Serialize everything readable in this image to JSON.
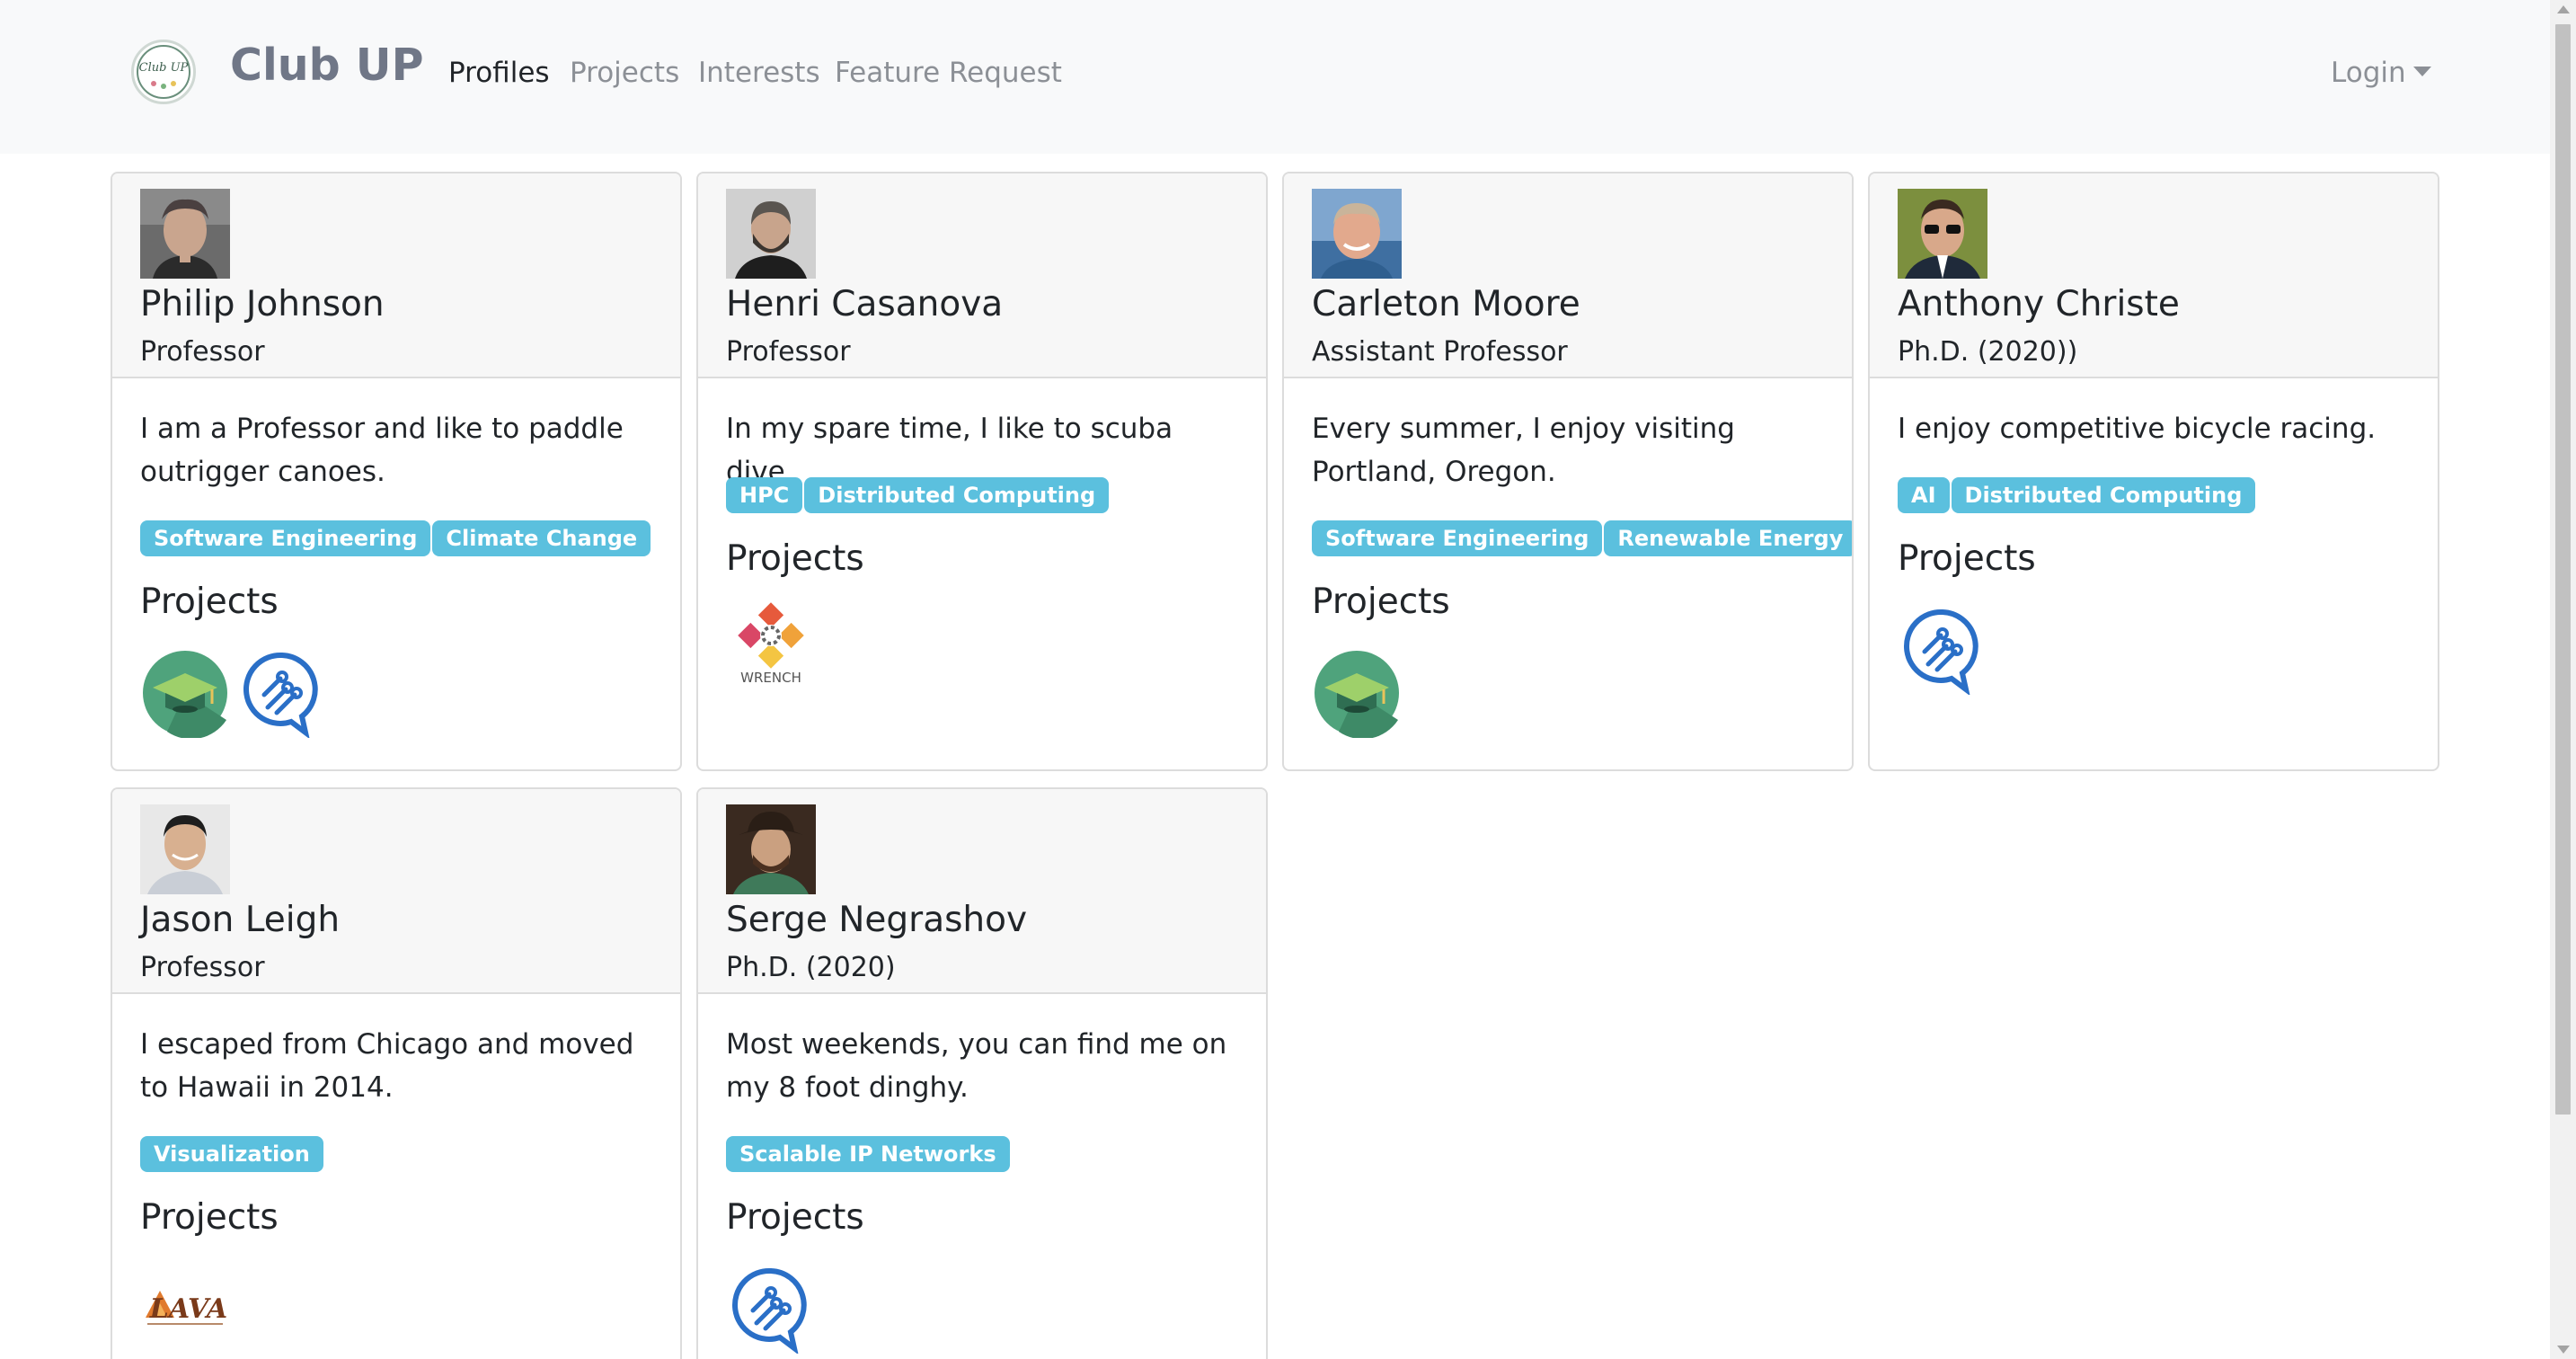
{
  "navbar": {
    "brand": "Club UP",
    "logo_text": "Club UP",
    "links": [
      {
        "label": "Profiles",
        "active": true
      },
      {
        "label": "Projects",
        "active": false
      },
      {
        "label": "Interests",
        "active": false
      },
      {
        "label": "Feature Request",
        "active": false
      }
    ],
    "login_label": "Login"
  },
  "colors": {
    "navbar_bg": "#f8f9fa",
    "badge_bg": "#5bc0de",
    "card_header_bg": "#f7f7f7"
  },
  "profiles": [
    {
      "name": "Philip Johnson",
      "title": "Professor",
      "bio": "I am a Professor and like to paddle outrigger canoes.",
      "interests": [
        "Software Engineering",
        "Climate Change"
      ],
      "projects_heading": "Projects",
      "projects": [
        "graduation-cap-icon",
        "chat-circuit-icon"
      ]
    },
    {
      "name": "Henri Casanova",
      "title": "Professor",
      "bio": "In my spare time, I like to scuba dive.",
      "interests": [
        "HPC",
        "Distributed Computing"
      ],
      "projects_heading": "Projects",
      "projects": [
        "wrench-logo-icon"
      ],
      "project_labels": [
        "WRENCH"
      ]
    },
    {
      "name": "Carleton Moore",
      "title": "Assistant Professor",
      "bio": "Every summer, I enjoy visiting Portland, Oregon.",
      "interests": [
        "Software Engineering",
        "Renewable Energy"
      ],
      "projects_heading": "Projects",
      "projects": [
        "graduation-cap-icon"
      ]
    },
    {
      "name": "Anthony Christe",
      "title": "Ph.D. (2020))",
      "bio": "I enjoy competitive bicycle racing.",
      "interests": [
        "AI",
        "Distributed Computing"
      ],
      "projects_heading": "Projects",
      "projects": [
        "chat-circuit-icon"
      ]
    },
    {
      "name": "Jason Leigh",
      "title": "Professor",
      "bio": "I escaped from Chicago and moved to Hawaii in 2014.",
      "interests": [
        "Visualization"
      ],
      "projects_heading": "Projects",
      "projects": [
        "lava-logo-icon"
      ],
      "project_labels": [
        "LAVA"
      ]
    },
    {
      "name": "Serge Negrashov",
      "title": "Ph.D. (2020)",
      "bio": "Most weekends, you can find me on my 8 foot dinghy.",
      "interests": [
        "Scalable IP Networks"
      ],
      "projects_heading": "Projects",
      "projects": [
        "chat-circuit-icon"
      ]
    }
  ]
}
